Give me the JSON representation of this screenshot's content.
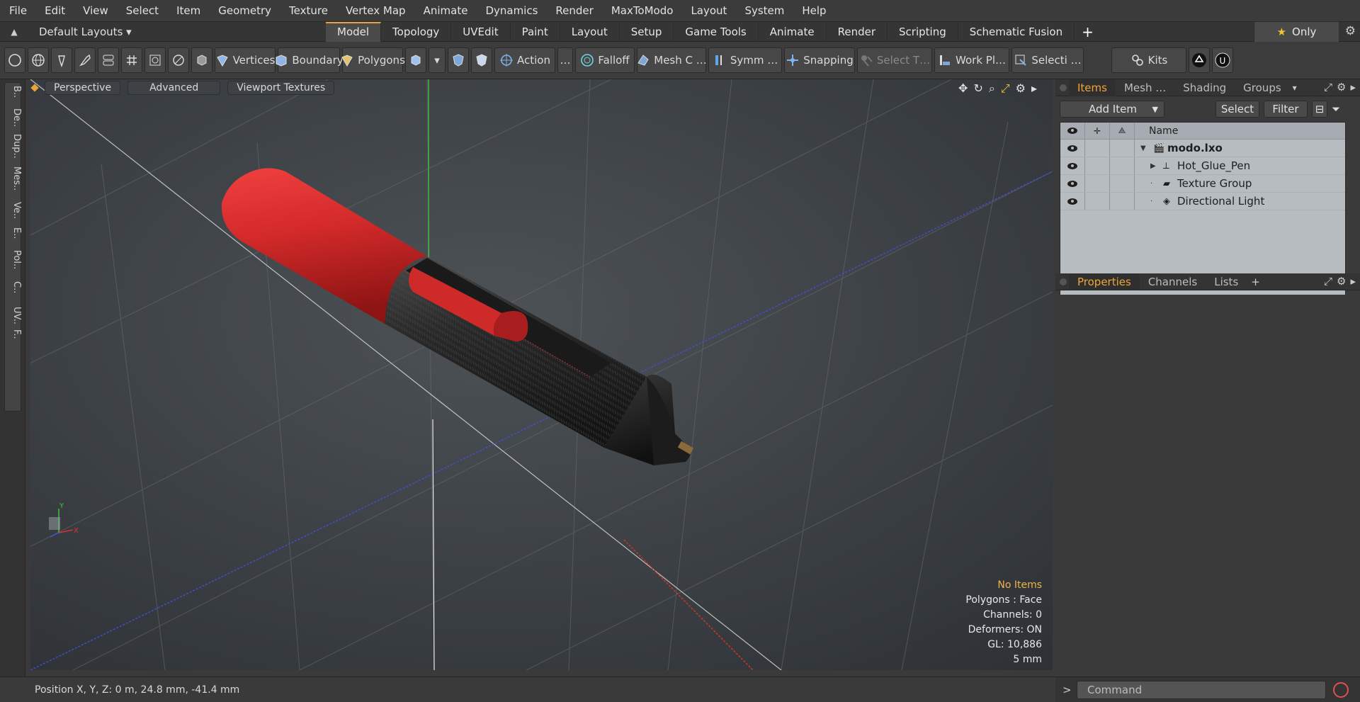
{
  "menu": [
    "File",
    "Edit",
    "View",
    "Select",
    "Item",
    "Geometry",
    "Texture",
    "Vertex Map",
    "Animate",
    "Dynamics",
    "Render",
    "MaxToModo",
    "Layout",
    "System",
    "Help"
  ],
  "layouts": {
    "default_label": "Default Layouts ▾",
    "tabs": [
      "Model",
      "Topology",
      "UVEdit",
      "Paint",
      "Layout",
      "Setup",
      "Game Tools",
      "Animate",
      "Render",
      "Scripting",
      "Schematic Fusion"
    ],
    "active": "Model",
    "add_tab": "+",
    "only": "Only"
  },
  "toolbar": {
    "vertices": "Vertices",
    "boundary": "Boundary",
    "polygons": "Polygons",
    "action": "Action",
    "action_more": "…",
    "falloff": "Falloff",
    "mesh": "Mesh C …",
    "symm": "Symm …",
    "snapping": "Snapping",
    "select_t": "Select T…",
    "work_plane": "Work Pl…",
    "selection": "Selecti …",
    "kits": "Kits"
  },
  "left_tabs": [
    "B..",
    "De..",
    "Dup..",
    "Mes..",
    "Ve..",
    "E..",
    "Pol..",
    "C..",
    "UV..",
    "F.."
  ],
  "viewport": {
    "mode": "Perspective",
    "advanced": "Advanced",
    "textures": "Viewport Textures",
    "stats": {
      "selection": "No Items",
      "polygons": "Polygons : Face",
      "channels": "Channels: 0",
      "deformers": "Deformers: ON",
      "gl": "GL: 10,886",
      "scale": "5 mm"
    },
    "accent": "#f2b44a"
  },
  "status": {
    "position": "Position X, Y, Z:   0 m, 24.8 mm, -41.4 mm"
  },
  "items_panel": {
    "tabs": [
      "Items",
      "Mesh …",
      "Shading",
      "Groups"
    ],
    "active": "Items",
    "add_item": "Add Item",
    "select": "Select",
    "filter": "Filter",
    "name_header": "Name",
    "rows": [
      {
        "name": "modo.lxo",
        "bold": true,
        "icon": "clapper-icon"
      },
      {
        "name": "Hot_Glue_Pen",
        "bold": false,
        "icon": "mesh-locator-icon"
      },
      {
        "name": "Texture Group",
        "bold": false,
        "icon": "texture-group-icon"
      },
      {
        "name": "Directional Light",
        "bold": false,
        "icon": "light-icon"
      }
    ]
  },
  "properties_panel": {
    "tabs": [
      "Properties",
      "Channels",
      "Lists"
    ],
    "active": "Properties",
    "add": "+"
  },
  "command": {
    "placeholder": "Command",
    "prompt": ">"
  }
}
